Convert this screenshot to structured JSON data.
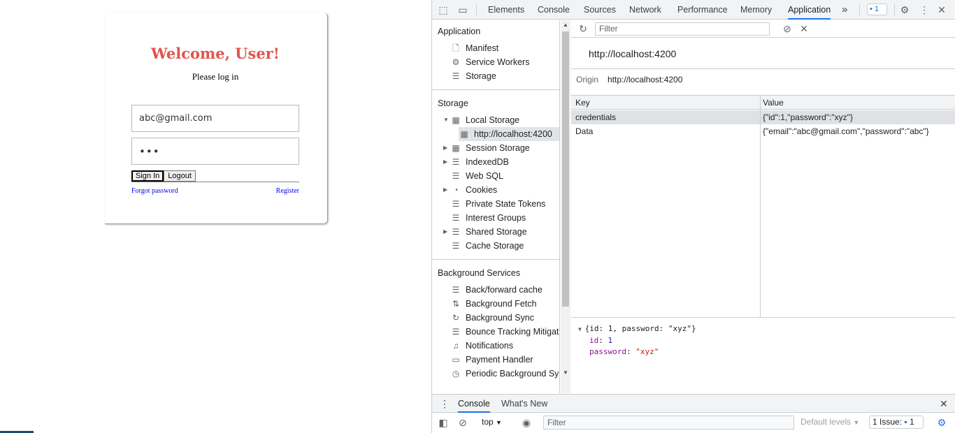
{
  "login": {
    "title": "Welcome, User!",
    "subtitle": "Please log in",
    "email_value": "abc@gmail.com",
    "password_value": "•••",
    "signin_label": "Sign In",
    "logout_label": "Logout",
    "forgot_label": "Forgot password",
    "register_label": "Register"
  },
  "devtools": {
    "tabs": [
      "Elements",
      "Console",
      "Sources",
      "Network",
      "Performance",
      "Memory",
      "Application"
    ],
    "more_tabs": "»",
    "issue_badge": "1",
    "sidebar": {
      "app_section": "Application",
      "app_items": [
        "Manifest",
        "Service Workers",
        "Storage"
      ],
      "storage_section": "Storage",
      "storage_items": [
        "Local Storage",
        "http://localhost:4200",
        "Session Storage",
        "IndexedDB",
        "Web SQL",
        "Cookies",
        "Private State Tokens",
        "Interest Groups",
        "Shared Storage",
        "Cache Storage"
      ],
      "bg_section": "Background Services",
      "bg_items": [
        "Back/forward cache",
        "Background Fetch",
        "Background Sync",
        "Bounce Tracking Mitigatic",
        "Notifications",
        "Payment Handler",
        "Periodic Background Sync"
      ]
    },
    "main": {
      "filter_placeholder": "Filter",
      "origin_title": "http://localhost:4200",
      "origin_label": "Origin",
      "origin_value": "http://localhost:4200",
      "columns": [
        "Key",
        "Value"
      ],
      "rows": [
        {
          "key": "credentials",
          "value": "{\"id\":1,\"password\":\"xyz\"}"
        },
        {
          "key": "Data",
          "value": "{\"email\":\"abc@gmail.com\",\"password\":\"abc\"}"
        }
      ],
      "preview": {
        "summary": "{id: 1, password: \"xyz\"}",
        "id_key": "id",
        "id_value": "1",
        "pw_key": "password",
        "pw_value": "\"xyz\""
      }
    },
    "drawer": {
      "tabs": [
        "Console",
        "What's New"
      ],
      "context": "top",
      "filter_placeholder": "Filter",
      "levels": "Default levels",
      "issues_label": "1 Issue:",
      "issues_count": "1"
    }
  }
}
